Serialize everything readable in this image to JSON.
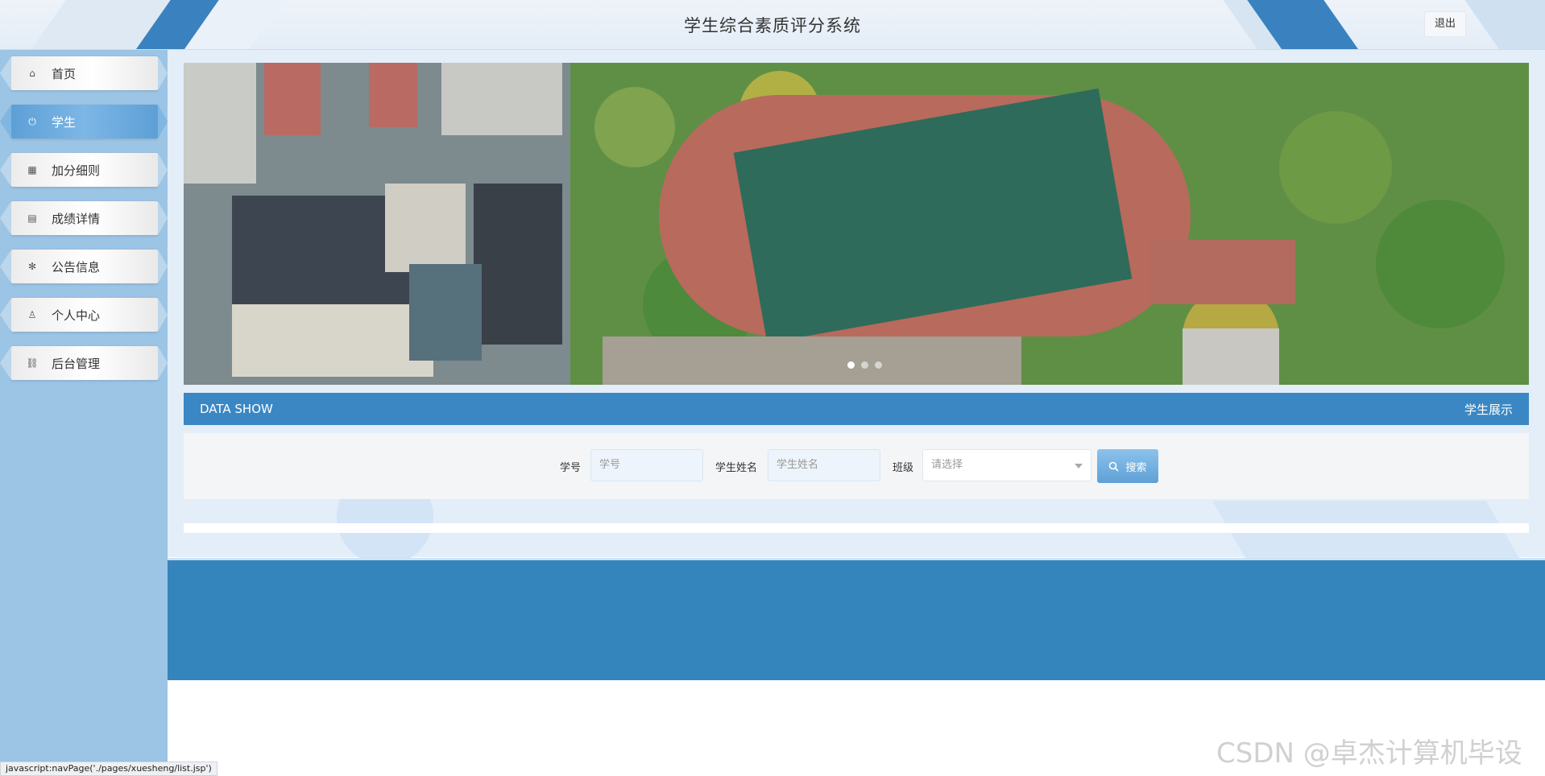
{
  "header": {
    "title": "学生综合素质评分系统",
    "logout_label": "退出"
  },
  "sidebar": {
    "items": [
      {
        "label": "首页",
        "icon": "home-icon",
        "glyph": "⌂",
        "active": false
      },
      {
        "label": "学生",
        "icon": "power-icon",
        "glyph": "⏻",
        "active": true
      },
      {
        "label": "加分细则",
        "icon": "grid-icon",
        "glyph": "▦",
        "active": false
      },
      {
        "label": "成绩详情",
        "icon": "document-icon",
        "glyph": "▤",
        "active": false
      },
      {
        "label": "公告信息",
        "icon": "snowflake-icon",
        "glyph": "✻",
        "active": false
      },
      {
        "label": "个人中心",
        "icon": "user-icon",
        "glyph": "♙",
        "active": false
      },
      {
        "label": "后台管理",
        "icon": "link-icon",
        "glyph": "⛓",
        "active": false
      }
    ]
  },
  "banner": {
    "slides": 3,
    "active_slide": 1
  },
  "section": {
    "title_left": "DATA SHOW",
    "title_right": "学生展示"
  },
  "search": {
    "student_no_label": "学号",
    "student_no_placeholder": "学号",
    "student_name_label": "学生姓名",
    "student_name_placeholder": "学生姓名",
    "class_label": "班级",
    "class_placeholder": "请选择",
    "button_label": "搜索",
    "button_icon": "search-icon"
  },
  "statusbar": {
    "text": "javascript:navPage('./pages/xuesheng/list.jsp')"
  },
  "watermark": "CSDN @卓杰计算机毕设",
  "colors": {
    "primary": "#3a87c4",
    "sidebar": "#9cc4e5",
    "footer": "#3585bd",
    "active_nav": "#5d9fd6"
  }
}
